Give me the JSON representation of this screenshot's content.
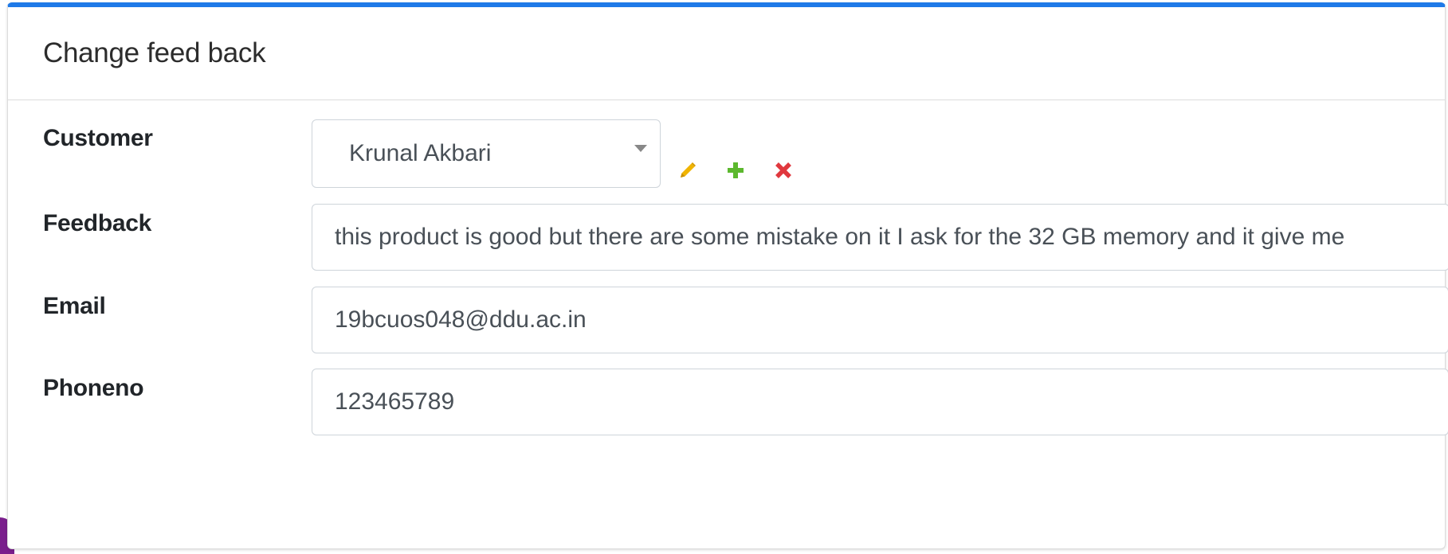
{
  "card": {
    "title": "Change feed back"
  },
  "form": {
    "customer": {
      "label": "Customer",
      "selected": "Krunal Akbari",
      "actions": {
        "edit_icon": "pencil-icon",
        "add_icon": "plus-icon",
        "delete_icon": "close-icon"
      }
    },
    "feedback": {
      "label": "Feedback",
      "value": "this product is good but there are some mistake on it I ask for the 32 GB memory and it give me"
    },
    "email": {
      "label": "Email",
      "value": "19bcuos048@ddu.ac.in"
    },
    "phone": {
      "label": "Phoneno",
      "value": "123465789"
    }
  },
  "colors": {
    "accent_top_border": "#1f7ae8",
    "edit_icon": "#f0b400",
    "add_icon": "#5cb82e",
    "delete_icon": "#e0383e",
    "corner_accent": "#7a1f8c"
  }
}
